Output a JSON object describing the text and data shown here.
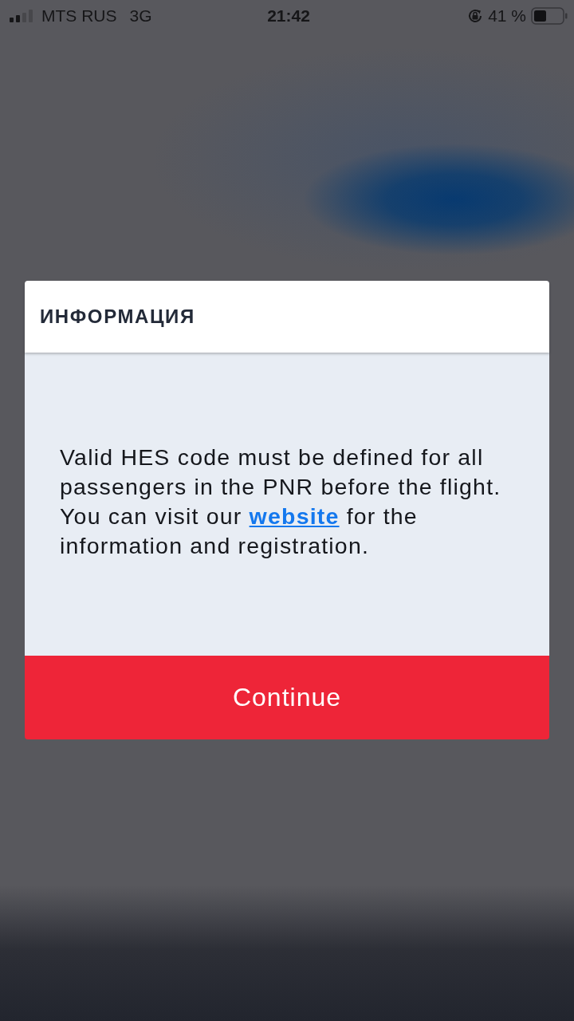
{
  "status_bar": {
    "carrier": "MTS RUS",
    "network": "3G",
    "time": "21:42",
    "battery": "41 %"
  },
  "dialog": {
    "title": "ИНФОРМАЦИЯ",
    "message": {
      "text_before": "Valid HES code must be defined for all passengers in the PNR before the flight. You can visit our",
      "link": "website",
      "text_after": "for the information and registration."
    },
    "button": "Continue"
  }
}
